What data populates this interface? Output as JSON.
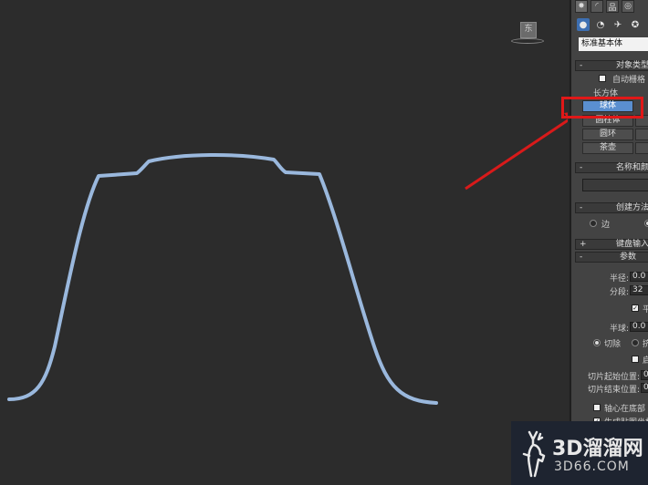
{
  "command_panel": {
    "tabs": [
      {
        "icon": "create-icon",
        "glyph": "✸"
      },
      {
        "icon": "modify-icon",
        "glyph": "◜"
      },
      {
        "icon": "hierarchy-icon",
        "glyph": "品"
      },
      {
        "icon": "motion-icon",
        "glyph": "◎"
      }
    ],
    "subicons": [
      {
        "icon": "geometry-icon",
        "glyph": "●"
      },
      {
        "icon": "shapes-icon",
        "glyph": "◔"
      },
      {
        "icon": "lights-icon",
        "glyph": "✈"
      },
      {
        "icon": "cameras-icon",
        "glyph": "✪"
      },
      {
        "icon": "helpers-icon",
        "glyph": "◍"
      }
    ],
    "category_dropdown": "标准基本体",
    "object_type": {
      "title": "对象类型",
      "autogrid_label": "自动栅格",
      "buttons": [
        "长方体",
        "球体",
        "圆柱体",
        "圆环",
        "茶壶"
      ],
      "selected": "球体"
    },
    "name_color": {
      "title": "名称和颜色",
      "name_value": ""
    },
    "creation_method": {
      "title": "创建方法",
      "edge_label": "边"
    },
    "keyboard_entry": {
      "title": "键盘输入"
    },
    "parameters": {
      "title": "参数",
      "radius_label": "半径:",
      "radius_value": "0.0",
      "segments_label": "分段:",
      "segments_value": "32",
      "smooth_label": "平",
      "hemisphere_label": "半球:",
      "hemisphere_value": "0.0",
      "chop_label": "切除",
      "squash_label": "挤",
      "slice_on_label": "启",
      "slice_from_label": "切片起始位置:",
      "slice_from_value": "0.",
      "slice_to_label": "切片结束位置:",
      "slice_to_value": "0.",
      "base_to_pivot_label": "轴心在底部",
      "gen_mapping_label": "生成贴图坐标"
    }
  },
  "viewcube_label": "东",
  "watermark": {
    "logo_text": "3D溜溜网",
    "url_text": "3D66.COM"
  },
  "colors": {
    "spline": "#9ab8dd",
    "highlight_box": "#e01818",
    "arrow": "#d81a1a",
    "selected_button": "#5a8fd0"
  }
}
